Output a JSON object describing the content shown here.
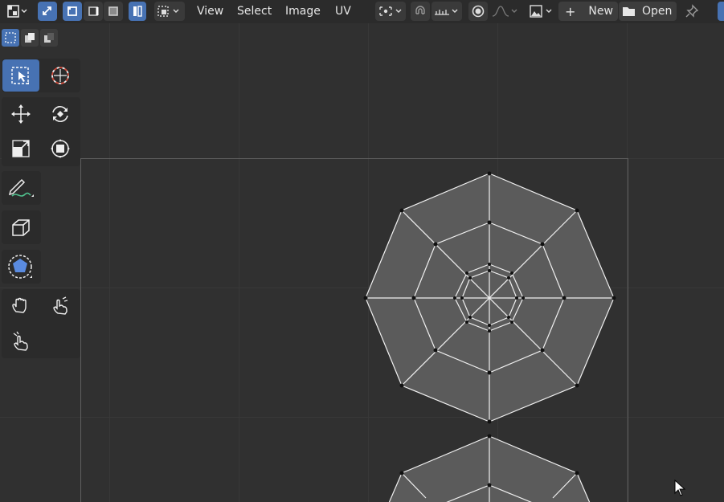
{
  "header": {
    "menus": {
      "view": "View",
      "select": "Select",
      "image": "Image",
      "uv": "UV"
    },
    "new_label": "New",
    "open_label": "Open"
  },
  "colors": {
    "accent": "#4772b3",
    "background": "#303030",
    "header": "#2b2b2b",
    "mesh_fill": "#5b5b5b",
    "edge": "#f2f2f2"
  },
  "toolbar": {
    "tools": [
      "select-box",
      "cursor",
      "move",
      "rotate",
      "scale",
      "transform",
      "annotate",
      "relax",
      "sculpt",
      "grab",
      "pinch",
      "pinch-alt"
    ]
  }
}
